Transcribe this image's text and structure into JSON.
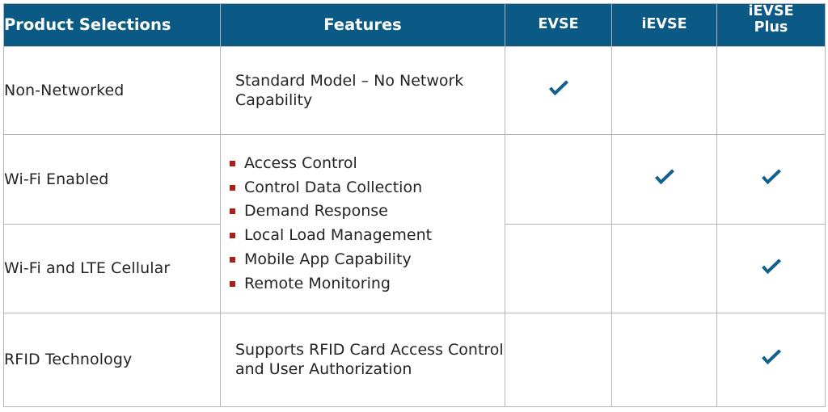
{
  "table": {
    "headers": {
      "product_selections": "Product Selections",
      "features": "Features",
      "evse": "EVSE",
      "ievse": "iEVSE",
      "ievse_plus_line1": "iEVSE",
      "ievse_plus_line2": "Plus"
    },
    "rows": [
      {
        "product": "Non-Networked",
        "feature_text": "Standard Model – No Network Capability",
        "evse": "check",
        "ievse": "",
        "ievse_plus": ""
      },
      {
        "product": "Wi-Fi Enabled",
        "feature_bullets": [
          "Access Control",
          "Control Data Collection",
          "Demand Response",
          "Local Load Management",
          "Mobile App Capability",
          "Remote Monitoring"
        ],
        "evse": "",
        "ievse": "check",
        "ievse_plus": "check"
      },
      {
        "product": "Wi-Fi and LTE Cellular",
        "evse": "",
        "ievse": "",
        "ievse_plus": "check"
      },
      {
        "product": "RFID Technology",
        "feature_text": "Supports RFID Card Access Control and User Authorization",
        "evse": "",
        "ievse": "",
        "ievse_plus": "check"
      }
    ],
    "bullets": {
      "0": "Access Control",
      "1": "Control Data Collection",
      "2": "Demand Response",
      "3": "Local Load Management",
      "4": "Mobile App Capability",
      "5": "Remote Monitoring"
    }
  },
  "colors": {
    "header_background": "#0b5a85",
    "header_text": "#ffffff",
    "check_mark": "#14608c",
    "bullet": "#a8201a",
    "border": "#b3b5b8",
    "body_text": "#242424"
  }
}
